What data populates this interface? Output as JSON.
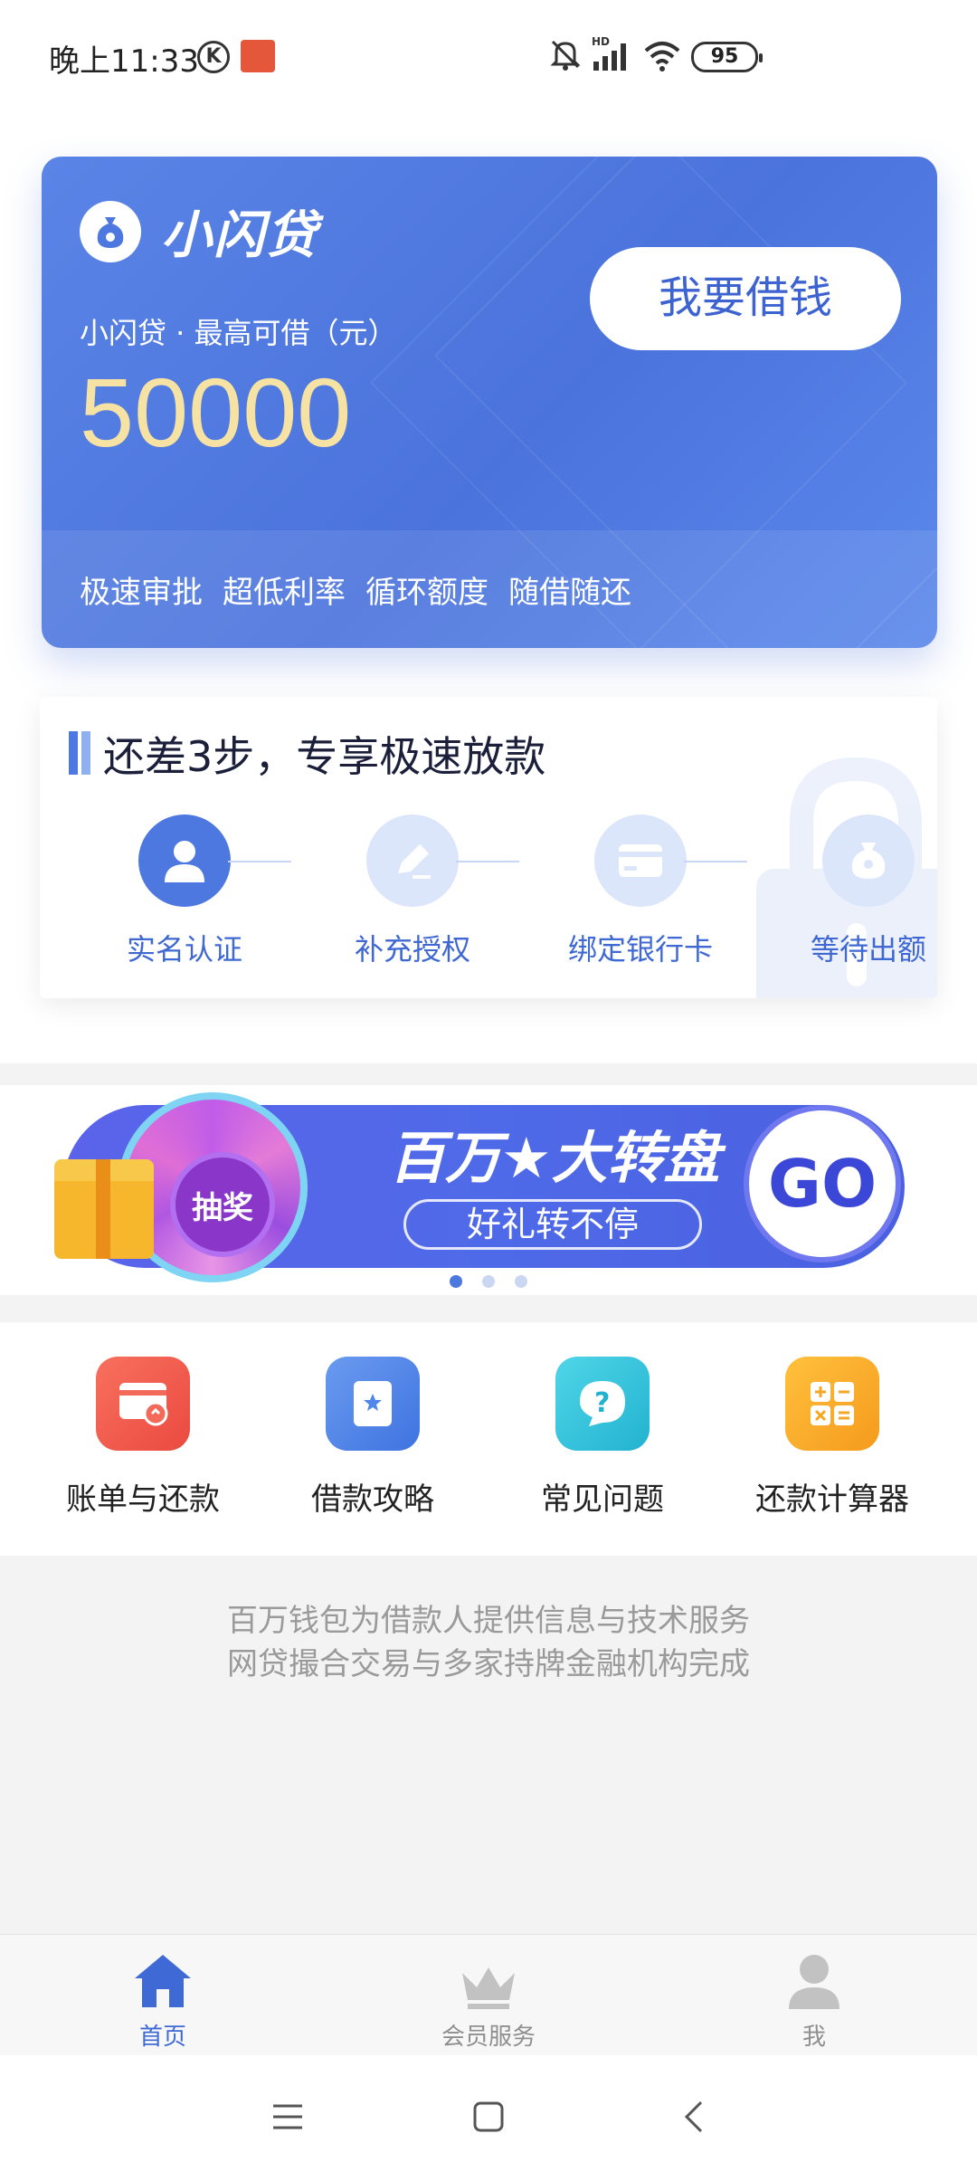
{
  "status_bar": {
    "time": "晚上11:33",
    "k_badge": "K",
    "battery": "95",
    "icons": [
      "mute-icon",
      "hd-signal-icon",
      "wifi-icon",
      "battery-icon"
    ]
  },
  "hero": {
    "brand": "小闪贷",
    "subtitle": "小闪贷 · 最高可借（元）",
    "amount": "50000",
    "cta": "我要借钱",
    "tags": [
      "极速审批",
      "超低利率",
      "循环额度",
      "随借随还"
    ],
    "colors": {
      "bg": "#4f77de",
      "amount": "#f6e2a3",
      "cta_text": "#3d63d0"
    }
  },
  "steps": {
    "title": "还差3步，专享极速放款",
    "items": [
      {
        "label": "实名认证",
        "active": true,
        "icon": "user-icon"
      },
      {
        "label": "补充授权",
        "active": false,
        "icon": "pen-icon"
      },
      {
        "label": "绑定银行卡",
        "active": false,
        "icon": "card-icon"
      },
      {
        "label": "等待出额",
        "active": false,
        "icon": "money-bag-icon"
      }
    ]
  },
  "banner": {
    "wheel_label": "抽奖",
    "title": "百万★大转盘",
    "subtitle": "好礼转不停",
    "go": "GO",
    "dots": 3,
    "active_dot": 0
  },
  "quick_links": [
    {
      "label": "账单与还款",
      "icon": "bill-icon",
      "color": "#f05a4c"
    },
    {
      "label": "借款攻略",
      "icon": "guide-book-icon",
      "color": "#4f86ea"
    },
    {
      "label": "常见问题",
      "icon": "question-icon",
      "color": "#2cc0d8"
    },
    {
      "label": "还款计算器",
      "icon": "calculator-icon",
      "color": "#f7a824"
    }
  ],
  "disclaimer": {
    "line1": "百万钱包为借款人提供信息与技术服务",
    "line2": "网贷撮合交易与多家持牌金融机构完成"
  },
  "bottom_nav": [
    {
      "label": "首页",
      "icon": "home-icon",
      "active": true
    },
    {
      "label": "会员服务",
      "icon": "crown-icon",
      "active": false
    },
    {
      "label": "我",
      "icon": "profile-icon",
      "active": false
    }
  ],
  "system_nav": [
    "menu-icon",
    "home-square-icon",
    "back-icon"
  ]
}
